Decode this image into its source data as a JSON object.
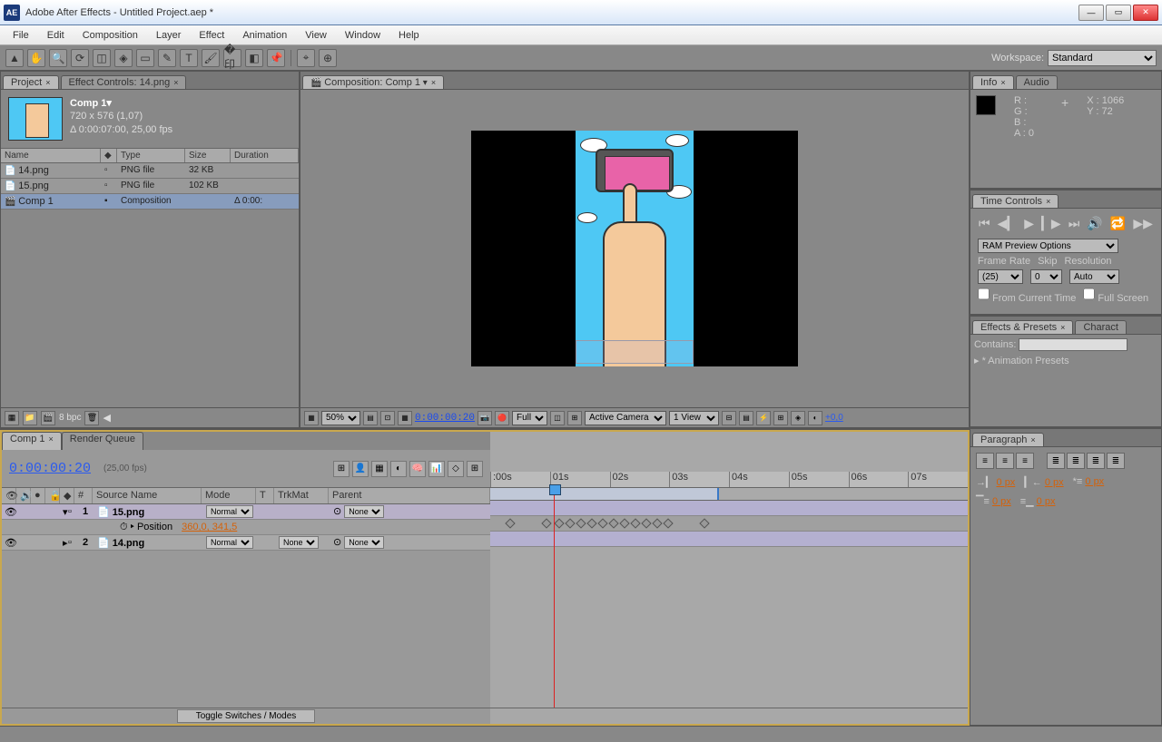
{
  "window": {
    "app_badge": "AE",
    "title": "Adobe After Effects - Untitled Project.aep *"
  },
  "menubar": [
    "File",
    "Edit",
    "Composition",
    "Layer",
    "Effect",
    "Animation",
    "View",
    "Window",
    "Help"
  ],
  "workspace": {
    "label": "Workspace:",
    "value": "Standard"
  },
  "project_panel": {
    "tab": "Project",
    "tab2": "Effect Controls: 14.png",
    "comp_name": "Comp 1▾",
    "dims": "720 x 576 (1,07)",
    "duration": "Δ 0:00:07:00, 25,00 fps",
    "headers": {
      "name": "Name",
      "type": "Type",
      "size": "Size",
      "duration": "Duration"
    },
    "rows": [
      {
        "name": "14.png",
        "type": "PNG file",
        "size": "32 KB",
        "duration": ""
      },
      {
        "name": "15.png",
        "type": "PNG file",
        "size": "102 KB",
        "duration": ""
      },
      {
        "name": "Comp 1",
        "type": "Composition",
        "size": "",
        "duration": "Δ 0:00:"
      }
    ],
    "bpc": "8 bpc"
  },
  "viewer": {
    "tab": "Composition: Comp 1",
    "zoom": "50%",
    "time": "0:00:00:20",
    "quality": "Full",
    "camera": "Active Camera",
    "views": "1 View",
    "exposure": "+0,0"
  },
  "info_panel": {
    "tab": "Info",
    "tab2": "Audio",
    "r": "R :",
    "g": "G :",
    "b": "B :",
    "a_label": "A :",
    "a_val": "0",
    "x": "X : 1066",
    "y": "Y : 72"
  },
  "time_controls": {
    "tab": "Time Controls",
    "ram_label": "RAM Preview Options",
    "frame_rate_label": "Frame Rate",
    "frame_rate": "(25)",
    "skip_label": "Skip",
    "skip": "0",
    "res_label": "Resolution",
    "res": "Auto",
    "from_current": "From Current Time",
    "full_screen": "Full Screen"
  },
  "effects_presets": {
    "tab": "Effects & Presets",
    "tab2": "Charact",
    "contains": "Contains:",
    "preset1": "* Animation Presets"
  },
  "timeline": {
    "tab1": "Comp 1",
    "tab2": "Render Queue",
    "time": "0:00:00:20",
    "fps": "(25,00 fps)",
    "cols": {
      "num": "#",
      "source": "Source Name",
      "mode": "Mode",
      "t": "T",
      "trkmat": "TrkMat",
      "parent": "Parent"
    },
    "layers": [
      {
        "num": "1",
        "name": "15.png",
        "mode": "Normal",
        "trkmat": "",
        "parent": "None"
      },
      {
        "num": "2",
        "name": "14.png",
        "mode": "Normal",
        "trkmat": "None",
        "parent": "None"
      }
    ],
    "prop": {
      "name": "Position",
      "value": "360,0, 341,5"
    },
    "ruler": [
      ":00s",
      "01s",
      "02s",
      "03s",
      "04s",
      "05s",
      "06s",
      "07s"
    ],
    "toggle": "Toggle Switches / Modes"
  },
  "paragraph": {
    "tab": "Paragraph",
    "indent_left": "0 px",
    "indent_right": "0 px",
    "indent_first": "0 px",
    "space_before": "0 px",
    "space_after": "0 px"
  }
}
